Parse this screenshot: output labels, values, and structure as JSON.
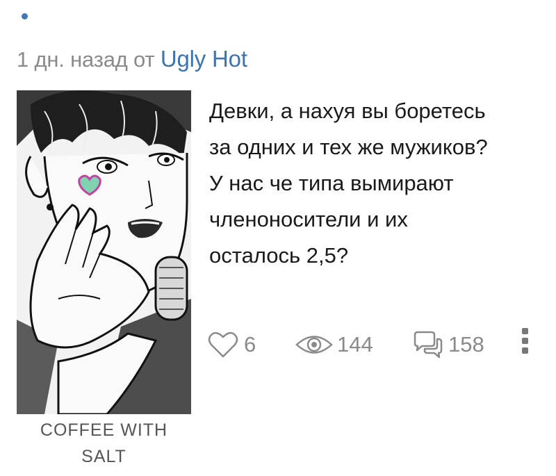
{
  "meta": {
    "time_ago": "1 дн. назад от",
    "author": "Ugly Hot"
  },
  "avatar": {
    "caption_line1": "COFFEE WITH",
    "caption_line2": "SALT"
  },
  "post": {
    "lines": [
      "Девки, а нахуя вы боретесь",
      "за одних и тех же мужиков?",
      "У нас че типа вымирают",
      "членоносители и их",
      "осталось 2,5?"
    ]
  },
  "stats": {
    "likes": "6",
    "views": "144",
    "comments": "158"
  },
  "icons": {
    "like": "heart-outline-icon",
    "views": "eye-icon",
    "comments": "speech-bubbles-icon",
    "more": "more-vertical-icon"
  },
  "colors": {
    "accent": "#3c74b0",
    "muted": "#8a8a8a",
    "text": "#1a1a1a"
  }
}
